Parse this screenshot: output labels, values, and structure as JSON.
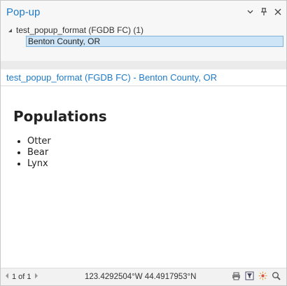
{
  "window": {
    "title": "Pop-up"
  },
  "tree": {
    "layer_label": "test_popup_format (FGDB FC) (1)",
    "selected_feature": "Benton County, OR"
  },
  "feature": {
    "title": "test_popup_format (FGDB FC) - Benton County, OR"
  },
  "popup_content": {
    "heading": "Populations",
    "items": [
      "Otter",
      "Bear",
      "Lynx"
    ]
  },
  "statusbar": {
    "page_indicator": "1 of 1",
    "coordinates": "123.4292504°W 44.4917953°N"
  },
  "colors": {
    "accent": "#1f7ac7",
    "selection": "#cde5f7"
  }
}
